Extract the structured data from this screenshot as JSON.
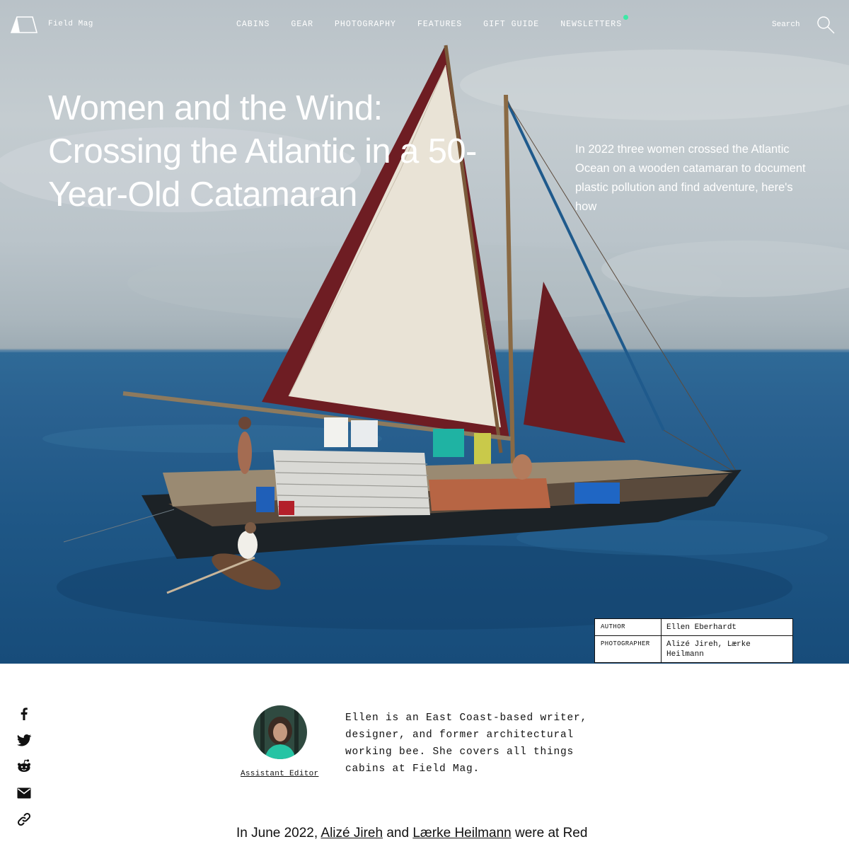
{
  "nav": {
    "brand": "Field Mag",
    "items": [
      {
        "label": "CABINS"
      },
      {
        "label": "GEAR"
      },
      {
        "label": "PHOTOGRAPHY"
      },
      {
        "label": "FEATURES"
      },
      {
        "label": "GIFT GUIDE"
      },
      {
        "label": "NEWSLETTERS"
      }
    ],
    "search_label": "Search",
    "newsletter_dot_color": "#3ee8a6"
  },
  "hero": {
    "headline": "Women and the Wind: Crossing the Atlantic in a 50-Year-Old Catamaran",
    "dek": "In 2022 three women crossed the Atlantic Ocean on a wooden catamaran to document plastic pollution and find adventure, here's how",
    "image_icon": "sailboat-photo"
  },
  "credits": [
    {
      "key": "AUTHOR",
      "value": "Ellen Eberhardt"
    },
    {
      "key": "PHOTOGRAPHER",
      "value": "Alizé Jireh, Lærke Heilmann"
    }
  ],
  "share": {
    "icons": [
      "facebook-icon",
      "twitter-icon",
      "reddit-icon",
      "email-icon",
      "link-icon"
    ]
  },
  "author": {
    "role": "Assistant Editor",
    "bio": "Ellen is an East Coast-based writer, designer, and former architectural working bee. She covers all things cabins at Field Mag."
  },
  "article": {
    "intro_prefix": "In June 2022, ",
    "link1": "Alizé Jireh",
    "mid": " and ",
    "link2": "Lærke Heilmann",
    "suffix": " were at Red"
  }
}
